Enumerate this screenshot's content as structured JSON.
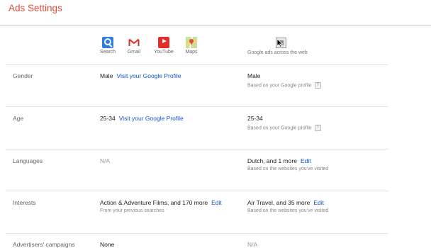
{
  "header": {
    "title": "Ads Settings"
  },
  "services": [
    {
      "label": "Search",
      "icon": "search-icon"
    },
    {
      "label": "Gmail",
      "icon": "gmail-icon"
    },
    {
      "label": "YouTube",
      "icon": "youtube-icon"
    },
    {
      "label": "Maps",
      "icon": "maps-icon"
    }
  ],
  "web_column": {
    "label": "Google ads across the web",
    "icon": "web-ads-icon"
  },
  "rows": [
    {
      "label": "Gender",
      "services_value": "Male",
      "services_link": "Visit your Google Profile",
      "web_value": "Male",
      "web_sub": "Based on your Google profile"
    },
    {
      "label": "Age",
      "services_value": "25-34",
      "services_link": "Visit your Google Profile",
      "web_value": "25-34",
      "web_sub": "Based on your Google profile"
    },
    {
      "label": "Languages",
      "services_value": "N/A",
      "web_value": "Dutch, and 1 more",
      "web_link": "Edit",
      "web_sub": "Based on the websites you've visited"
    },
    {
      "label": "Interests",
      "services_value": "Action & Adventure Films, and 170 more",
      "services_link": "Edit",
      "services_sub": "From your previous searches",
      "web_value": "Air Travel, and 35 more",
      "web_link": "Edit",
      "web_sub": "Based on the websites you've visited"
    },
    {
      "label": "Advertisers' campaigns",
      "services_value": "None",
      "web_value": "N/A"
    }
  ],
  "help_mark": "?",
  "colors": {
    "title": "#dd4b39",
    "link": "#1155cc",
    "divider": "#e5e5e5"
  }
}
